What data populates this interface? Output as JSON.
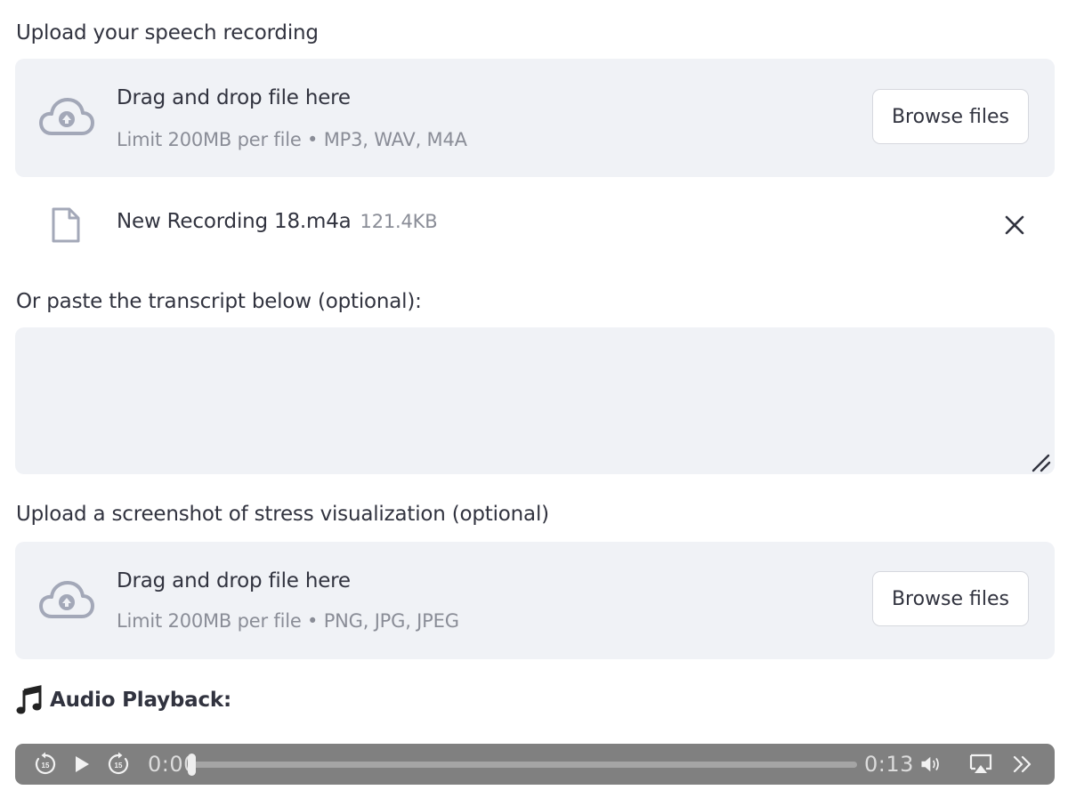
{
  "upload_speech": {
    "label": "Upload your speech recording",
    "dropzone_title": "Drag and drop file here",
    "dropzone_limits": "Limit 200MB per file • MP3, WAV, M4A",
    "browse_label": "Browse files",
    "icon": "cloud-upload-icon"
  },
  "uploaded_file": {
    "name": "New Recording 18.m4a",
    "size": "121.4KB",
    "icon": "file-icon"
  },
  "transcript": {
    "label": "Or paste the transcript below (optional):",
    "value": ""
  },
  "upload_screenshot": {
    "label": "Upload a screenshot of stress visualization (optional)",
    "dropzone_title": "Drag and drop file here",
    "dropzone_limits": "Limit 200MB per file • PNG, JPG, JPEG",
    "browse_label": "Browse files",
    "icon": "cloud-upload-icon"
  },
  "audio_section": {
    "title": "Audio Playback:",
    "icon": "music-note-icon"
  },
  "player": {
    "current_time": "0:00",
    "duration": "0:13",
    "progress": 0.0,
    "skip_seconds": "15"
  },
  "colors": {
    "dropzone_bg": "#f0f2f6",
    "text": "#31333f",
    "muted_text": "#8a8d97",
    "icon": "#a3a8b8",
    "player_bg": "#808080"
  }
}
